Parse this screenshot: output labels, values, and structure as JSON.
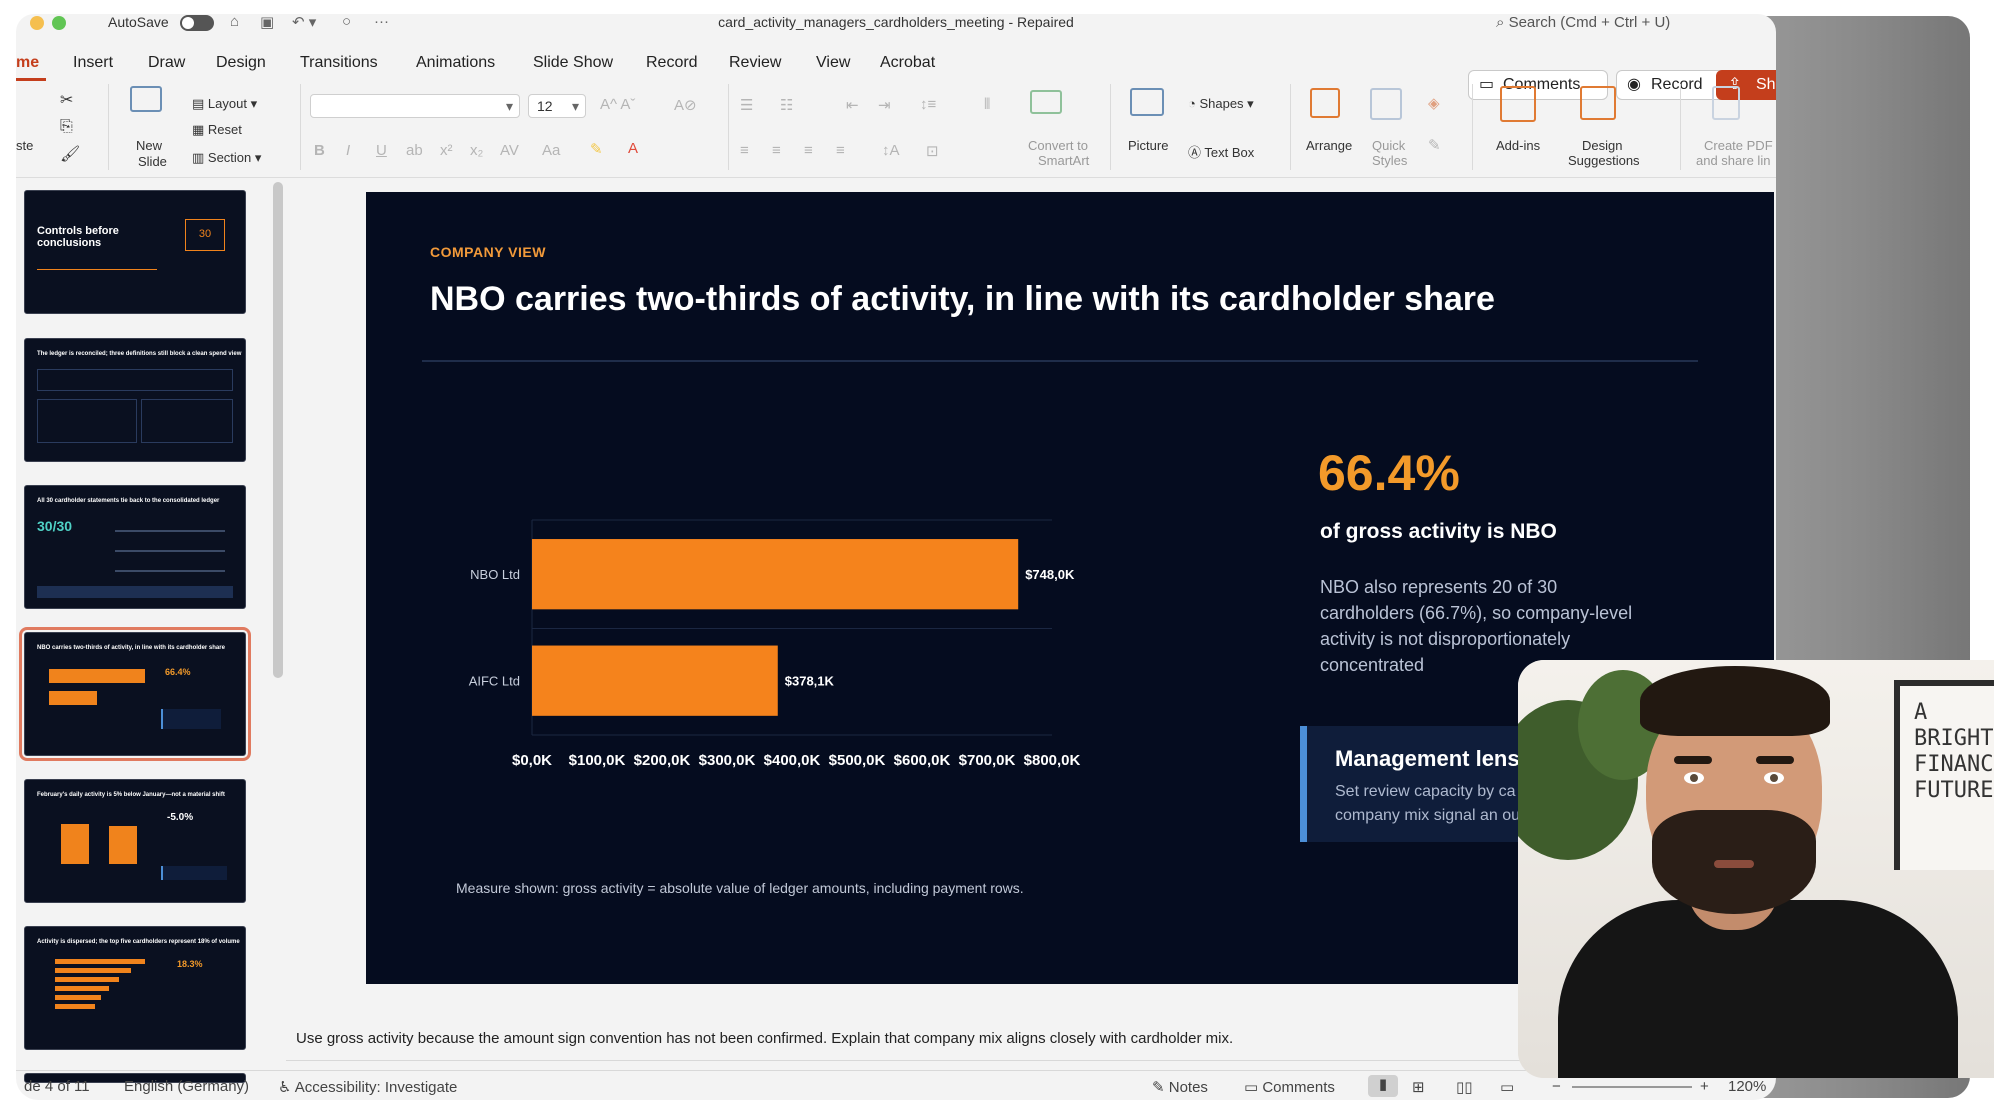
{
  "titlebar": {
    "autosave_label": "AutoSave",
    "document_title": "card_activity_managers_cardholders_meeting  -  Repaired",
    "search_placeholder": "Search (Cmd + Ctrl + U)"
  },
  "tabs": [
    "me",
    "Insert",
    "Draw",
    "Design",
    "Transitions",
    "Animations",
    "Slide Show",
    "Record",
    "Review",
    "View",
    "Acrobat"
  ],
  "actions": {
    "comments": "Comments",
    "record": "Record",
    "share": "Sh"
  },
  "ribbon": {
    "paste": "ste",
    "new_slide_1": "New",
    "new_slide_2": "Slide",
    "layout": "Layout",
    "reset": "Reset",
    "section": "Section",
    "font_size": "12",
    "convert_smartart_1": "Convert to",
    "convert_smartart_2": "SmartArt",
    "picture": "Picture",
    "shapes": "Shapes",
    "text_box": "Text Box",
    "arrange": "Arrange",
    "quick_styles_1": "Quick",
    "quick_styles_2": "Styles",
    "add_ins": "Add-ins",
    "design_suggestions_1": "Design",
    "design_suggestions_2": "Suggestions",
    "create_pdf_1": "Create PDF",
    "create_pdf_2": "and share lin"
  },
  "thumbnails": [
    {
      "title": "Controls before conclusions",
      "badge": "30"
    },
    {
      "title": "The ledger is reconciled; three definitions still block a clean spend view"
    },
    {
      "title": "All 30 cardholder statements tie back to the consolidated ledger",
      "big": "30/30"
    },
    {
      "title": "NBO carries two-thirds of activity, in line with its cardholder share"
    },
    {
      "title": "February's daily activity is 5% below January—not a material shift",
      "big": "-5.0%"
    },
    {
      "title": "Activity is dispersed; the top five cardholders represent 18% of volume",
      "big": "18.3%"
    }
  ],
  "slide": {
    "kicker": "COMPANY VIEW",
    "title": "NBO carries two-thirds of activity, in line with its cardholder share",
    "kpi_value": "66.4%",
    "kpi_label": "of gross activity is NBO",
    "kpi_body": "NBO also represents 20 of 30 cardholders (66.7%), so company-level activity is not disproportionately concentrated",
    "lens_title": "Management lens",
    "lens_body": "Set review capacity by ca count first; company mix signal an outlier.",
    "measure_note": "Measure shown: gross activity = absolute value of ledger amounts, including payment rows."
  },
  "chart_data": {
    "type": "bar",
    "orientation": "horizontal",
    "categories": [
      "NBO Ltd",
      "AIFC Ltd"
    ],
    "values": [
      748.0,
      378.1
    ],
    "data_labels": [
      "$748,0K",
      "$378,1K"
    ],
    "x_ticks": [
      "$0,0K",
      "$100,0K",
      "$200,0K",
      "$300,0K",
      "$400,0K",
      "$500,0K",
      "$600,0K",
      "$700,0K",
      "$800,0K"
    ],
    "xlim": [
      0,
      800
    ],
    "bar_color": "#f5831c",
    "grid": true
  },
  "notes_text": "Use gross activity because the amount sign convention has not been confirmed. Explain that company mix aligns closely with cardholder mix.",
  "status": {
    "slide_counter": "de 4 of 11",
    "language": "English (Germany)",
    "accessibility": "Accessibility: Investigate",
    "notes": "Notes",
    "comments": "Comments",
    "zoom": "120%"
  },
  "webcam": {
    "poster_text": "A\nBRIGHTE\nFINANCI\nFUTURE"
  },
  "colors": {
    "accent": "#c43e1c",
    "slide_bg": "#050c1f",
    "orange": "#f5831c",
    "lens_border": "#4c8fd8"
  }
}
